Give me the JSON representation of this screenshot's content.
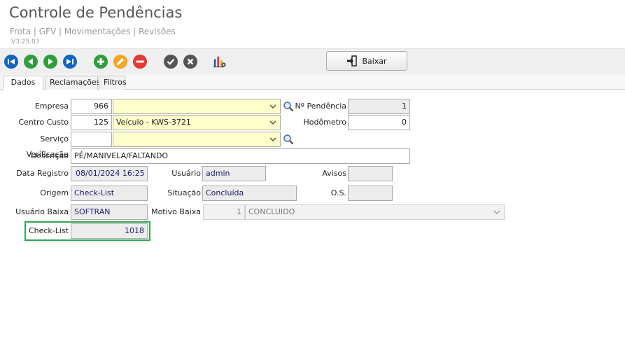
{
  "header": {
    "title": "Controle de Pendências",
    "breadcrumb": "Frota | GFV | Movimentações | Revisões",
    "version": "V3.25.03"
  },
  "toolbar": {
    "baixar_label": "Baixar",
    "icons": [
      "first-record-icon",
      "previous-record-icon",
      "next-record-icon",
      "last-record-icon",
      "add-icon",
      "edit-icon",
      "delete-icon",
      "confirm-icon",
      "cancel-icon",
      "report-icon"
    ]
  },
  "tabs": [
    {
      "label": "Dados",
      "active": true
    },
    {
      "label": "Reclamações",
      "active": false
    },
    {
      "label": "Filtros",
      "active": false
    }
  ],
  "form": {
    "empresa": {
      "label": "Empresa",
      "code": "966",
      "name": ""
    },
    "num_pendencia": {
      "label": "Nº Pendência",
      "value": "1"
    },
    "centro_custo": {
      "label": "Centro Custo",
      "code": "125",
      "name": "Veículo - KWS-3721"
    },
    "hodometro": {
      "label": "Hodômetro",
      "value": "0"
    },
    "servico_verificacao": {
      "label": "Serviço Verificação",
      "code": "",
      "name": ""
    },
    "descricao": {
      "label": "Descrição",
      "value": "PÉ/MANIVELA/FALTANDO"
    },
    "data_registro": {
      "label": "Data Registro",
      "value": "08/01/2024  16:25"
    },
    "usuario": {
      "label": "Usuário",
      "value": "admin"
    },
    "avisos": {
      "label": "Avisos",
      "value": ""
    },
    "origem": {
      "label": "Origem",
      "value": "Check-List"
    },
    "situacao": {
      "label": "Situação",
      "value": "Concluída"
    },
    "os": {
      "label": "O.S.",
      "value": ""
    },
    "usuario_baixa": {
      "label": "Usuário Baixa",
      "value": "SOFTRAN"
    },
    "motivo_baixa": {
      "label": "Motivo Baixa",
      "code": "1",
      "name": "CONCLUIDO"
    },
    "check_list": {
      "label": "Check-List",
      "value": "1018"
    }
  },
  "colors": {
    "accent_blue": "#1565c0",
    "green": "#2e9e3a",
    "orange": "#f5a623",
    "red": "#e53935",
    "gray_icon": "#555555",
    "highlight": "#2fa84f",
    "yellow_field": "#ffffcc"
  }
}
